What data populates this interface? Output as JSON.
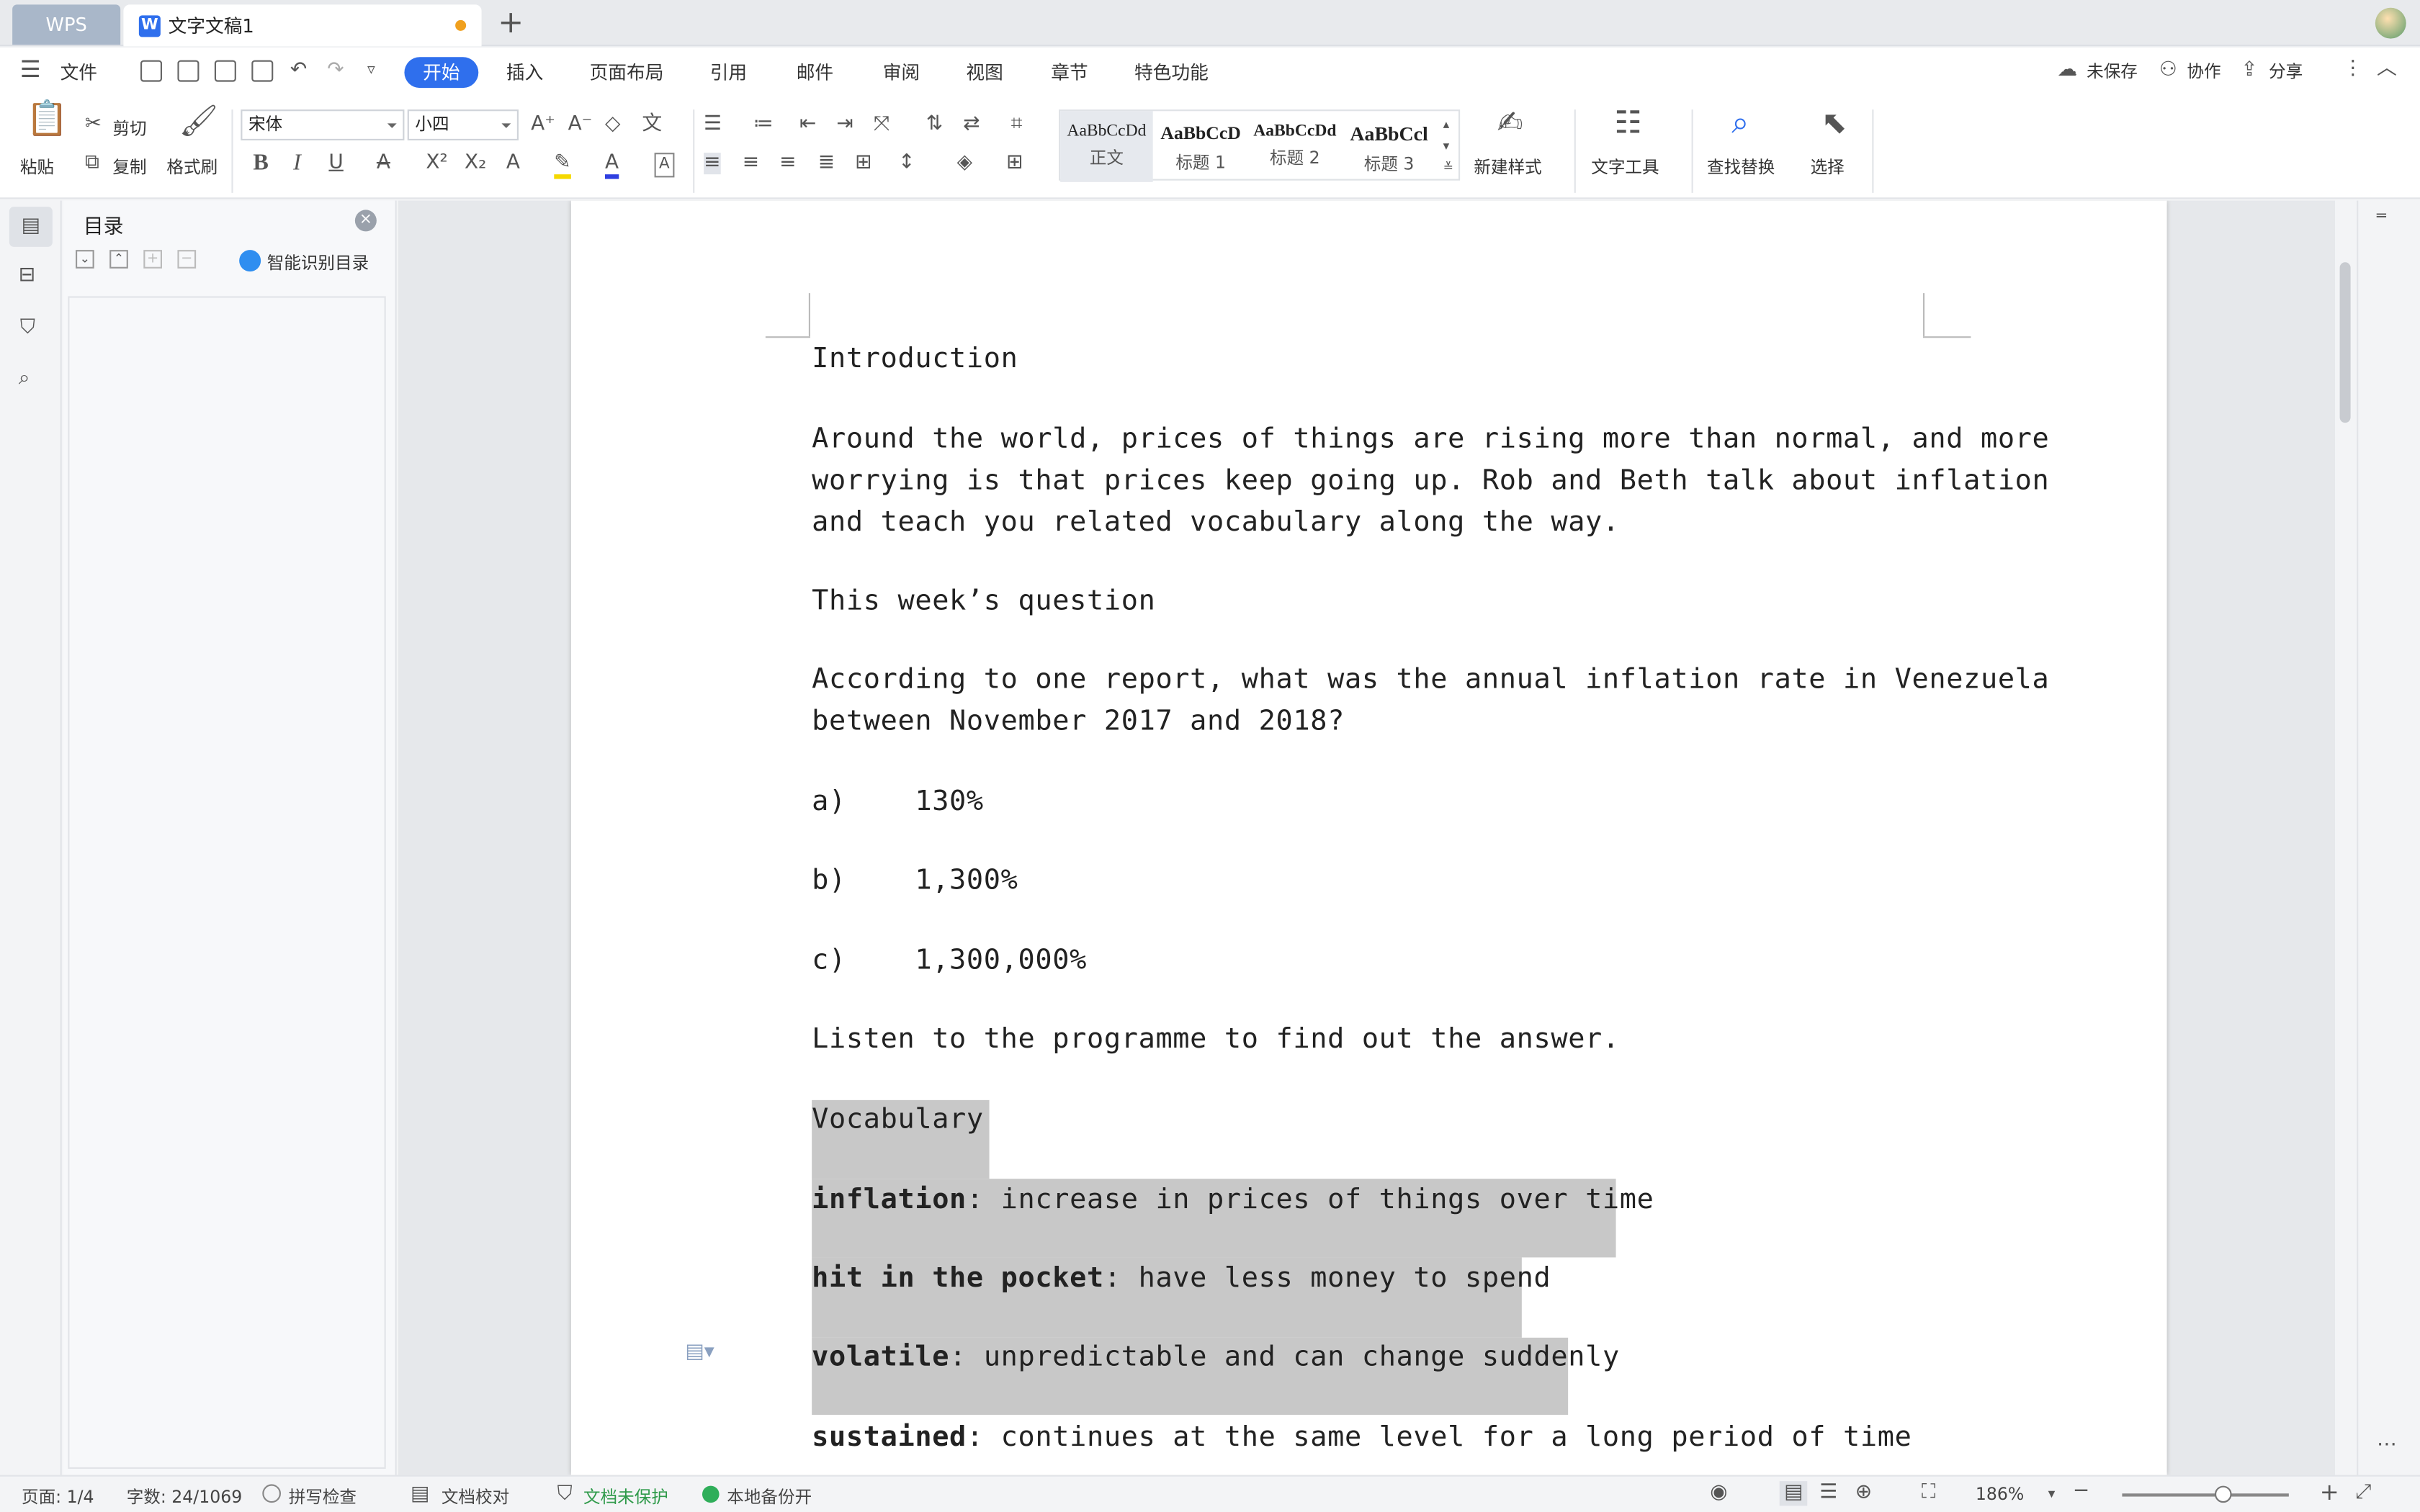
{
  "tabs": {
    "wps": "WPS",
    "doc_title": "文字文稿1",
    "new_tab": "+"
  },
  "menu": {
    "file": "文件",
    "items": [
      "开始",
      "插入",
      "页面布局",
      "引用",
      "邮件",
      "审阅",
      "视图",
      "章节",
      "特色功能"
    ],
    "unsaved": "未保存",
    "collab": "协作",
    "share": "分享"
  },
  "ribbon": {
    "paste": "粘贴",
    "cut": "剪切",
    "copy": "复制",
    "format_painter": "格式刷",
    "font_name": "宋体",
    "font_size": "小四",
    "styles": [
      {
        "sample": "AaBbCcDd",
        "name": "正文"
      },
      {
        "sample": "AaBbCcD",
        "name": "标题 1"
      },
      {
        "sample": "AaBbCcDd",
        "name": "标题 2"
      },
      {
        "sample": "AaBbCcl",
        "name": "标题 3"
      }
    ],
    "new_style": "新建样式",
    "text_tools": "文字工具",
    "find_replace": "查找替换",
    "select": "选择"
  },
  "toc": {
    "title": "目录",
    "smart": "智能识别目录"
  },
  "document": {
    "lines": [
      "Introduction",
      "Around the world, prices of things are rising more than normal, and more",
      "worrying is that prices keep going up. Rob and Beth talk about inflation",
      "and teach you related vocabulary along the way.",
      "This week’s question",
      "According to one report, what was the annual inflation rate in Venezuela",
      "between November 2017 and 2018?",
      "a)    130%",
      "b)    1,300%",
      "c)    1,300,000%",
      "Listen to the programme to find out the answer.",
      "Vocabulary"
    ],
    "vocab": [
      {
        "term": "inflation",
        "def": ": increase in prices of things over time"
      },
      {
        "term": "hit in the pocket",
        "def": ": have less money to spend"
      },
      {
        "term": "volatile",
        "def": ": unpredictable and can change suddenly"
      },
      {
        "term": "sustained",
        "def": ": continues at the same level for a long period of time"
      }
    ]
  },
  "status": {
    "page": "页面: 1/4",
    "words": "字数: 24/1069",
    "spell": "拼写检查",
    "proof": "文档校对",
    "protect": "文档未保护",
    "backup": "本地备份开",
    "zoom": "186%"
  }
}
